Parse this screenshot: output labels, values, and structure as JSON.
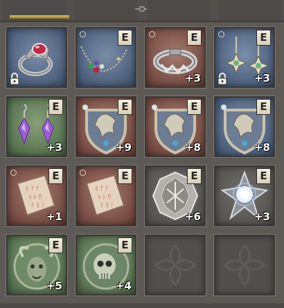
{
  "colors": {
    "blue": "#4e617e",
    "red": "#7a4f46",
    "green": "#5a7552",
    "empty": "#52504d",
    "badge": "#f4efe2"
  },
  "slots": [
    {
      "row": 0,
      "col": 0,
      "name": "ornate-ruby-ring",
      "bg": "blue",
      "equip": "",
      "level": "",
      "locked": true,
      "new": false
    },
    {
      "row": 0,
      "col": 1,
      "name": "gem-necklace",
      "bg": "blue",
      "equip": "E",
      "level": "",
      "locked": false,
      "new": true
    },
    {
      "row": 0,
      "col": 2,
      "name": "silver-bracelet",
      "bg": "red",
      "equip": "E",
      "level": "+3",
      "locked": false,
      "new": true
    },
    {
      "row": 0,
      "col": 3,
      "name": "star-earrings",
      "bg": "blue",
      "equip": "E",
      "level": "+3",
      "locked": true,
      "new": true
    },
    {
      "row": 1,
      "col": 0,
      "name": "amethyst-earrings",
      "bg": "green",
      "equip": "E",
      "level": "+3",
      "locked": false,
      "new": false
    },
    {
      "row": 1,
      "col": 1,
      "name": "dragon-crest-shield",
      "bg": "red",
      "equip": "E",
      "level": "+9",
      "locked": false,
      "new": false
    },
    {
      "row": 1,
      "col": 2,
      "name": "dragon-crest-shield",
      "bg": "red",
      "equip": "E",
      "level": "+8",
      "locked": false,
      "new": false
    },
    {
      "row": 1,
      "col": 3,
      "name": "dragon-crest-shield",
      "bg": "blue",
      "equip": "E",
      "level": "+8",
      "locked": false,
      "new": false
    },
    {
      "row": 2,
      "col": 0,
      "name": "rune-book",
      "bg": "red",
      "equip": "E",
      "level": "+1",
      "locked": false,
      "new": true
    },
    {
      "row": 2,
      "col": 1,
      "name": "rune-book",
      "bg": "red",
      "equip": "E",
      "level": "",
      "locked": false,
      "new": true
    },
    {
      "row": 2,
      "col": 2,
      "name": "ornate-emblem",
      "bg": "gray",
      "equip": "E",
      "level": "+6",
      "locked": false,
      "new": false
    },
    {
      "row": 2,
      "col": 3,
      "name": "crystal-star-emblem",
      "bg": "gray",
      "equip": "E",
      "level": "+3",
      "locked": false,
      "new": false
    },
    {
      "row": 3,
      "col": 0,
      "name": "demon-mask-emblem",
      "bg": "green",
      "equip": "E",
      "level": "+5",
      "locked": false,
      "new": false
    },
    {
      "row": 3,
      "col": 1,
      "name": "skull-emblem",
      "bg": "green",
      "equip": "E",
      "level": "+4",
      "locked": false,
      "new": false
    },
    {
      "row": 3,
      "col": 2,
      "name": "empty-slot",
      "bg": "empty",
      "equip": "",
      "level": "",
      "locked": false,
      "new": false
    },
    {
      "row": 3,
      "col": 3,
      "name": "empty-slot",
      "bg": "empty",
      "equip": "",
      "level": "",
      "locked": false,
      "new": false
    }
  ]
}
